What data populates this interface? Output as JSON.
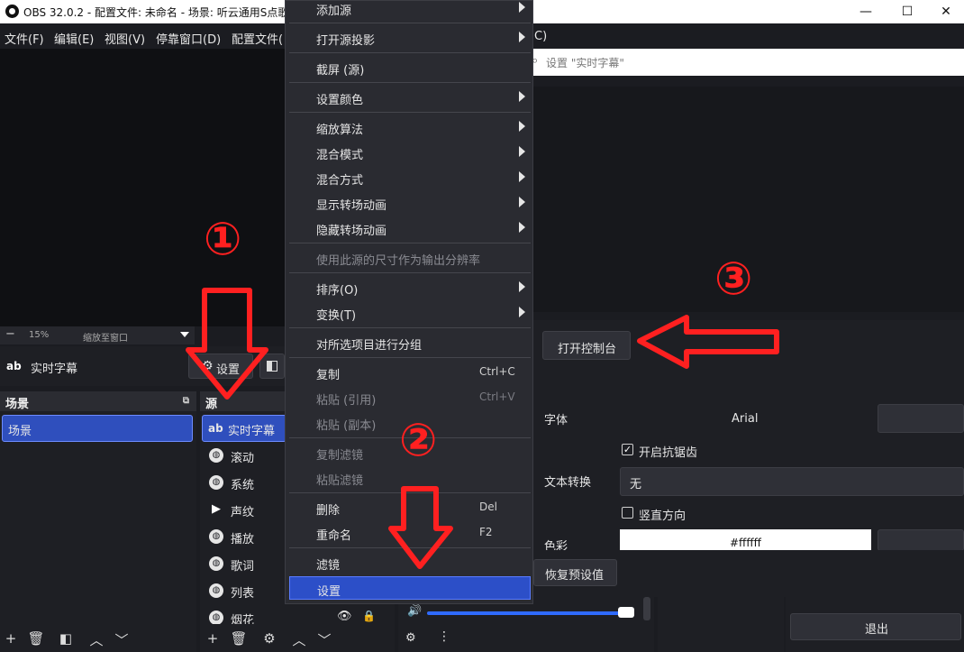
{
  "window": {
    "title": "OBS 32.0.2 - 配置文件: 未命名 - 场景: 听云通用S点歌",
    "minimize": "—",
    "maximize": "☐",
    "close": "✕"
  },
  "menubar": [
    "文件(F)",
    "编辑(E)",
    "视图(V)",
    "停靠窗口(D)",
    "配置文件(",
    "C)"
  ],
  "properties_filter": {
    "placeholder": "设置 \"实时字幕\""
  },
  "zoom": {
    "level": "15%",
    "mode": "缩放至窗口"
  },
  "source_toolbar": {
    "name": "实时字幕",
    "settings_button": "设置"
  },
  "scenes": {
    "title": "场景",
    "items": [
      "场景"
    ]
  },
  "sources": {
    "title": "源",
    "items": [
      {
        "label": "实时字幕",
        "icon": "text-icon"
      },
      {
        "label": "滚动",
        "icon": "globe-icon"
      },
      {
        "label": "系统",
        "icon": "globe-icon"
      },
      {
        "label": "声纹",
        "icon": "play-icon"
      },
      {
        "label": "播放",
        "icon": "globe-icon"
      },
      {
        "label": "歌词",
        "icon": "globe-icon"
      },
      {
        "label": "列表",
        "icon": "globe-icon"
      },
      {
        "label": "烟花",
        "icon": "globe-icon"
      }
    ]
  },
  "context_menu": {
    "add_source": "添加源",
    "open_projector": "打开源投影",
    "screenshot": "截屏 (源)",
    "set_color": "设置颜色",
    "scale_filter": "缩放算法",
    "blend_mode": "混合模式",
    "blend_method": "混合方式",
    "show_transition": "显示转场动画",
    "hide_transition": "隐藏转场动画",
    "resize_output": "使用此源的尺寸作为输出分辨率",
    "order": "排序(O)",
    "transform": "变换(T)",
    "group": "对所选项目进行分组",
    "copy": "复制",
    "copy_shortcut": "Ctrl+C",
    "paste_ref": "粘贴 (引用)",
    "paste_ref_shortcut": "Ctrl+V",
    "paste_dup": "粘贴 (副本)",
    "copy_filters": "复制滤镜",
    "paste_filters": "粘贴滤镜",
    "delete": "删除",
    "delete_shortcut": "Del",
    "rename": "重命名",
    "rename_shortcut": "F2",
    "filters": "滤镜",
    "properties": "设置"
  },
  "properties": {
    "open_console": "打开控制台",
    "font_label": "字体",
    "font_value": "Arial",
    "antialias_label": "开启抗锯齿",
    "antialias_checked": "✓",
    "transform_label": "文本转换",
    "transform_value": "无",
    "vertical_label": "竖直方向",
    "color_label": "色彩",
    "color_value": "#ffffff",
    "defaults_button": "恢复预设值"
  },
  "controls": {
    "exit": "退出"
  },
  "annotations": {
    "step1": "①",
    "step2": "②",
    "step3": "③"
  }
}
